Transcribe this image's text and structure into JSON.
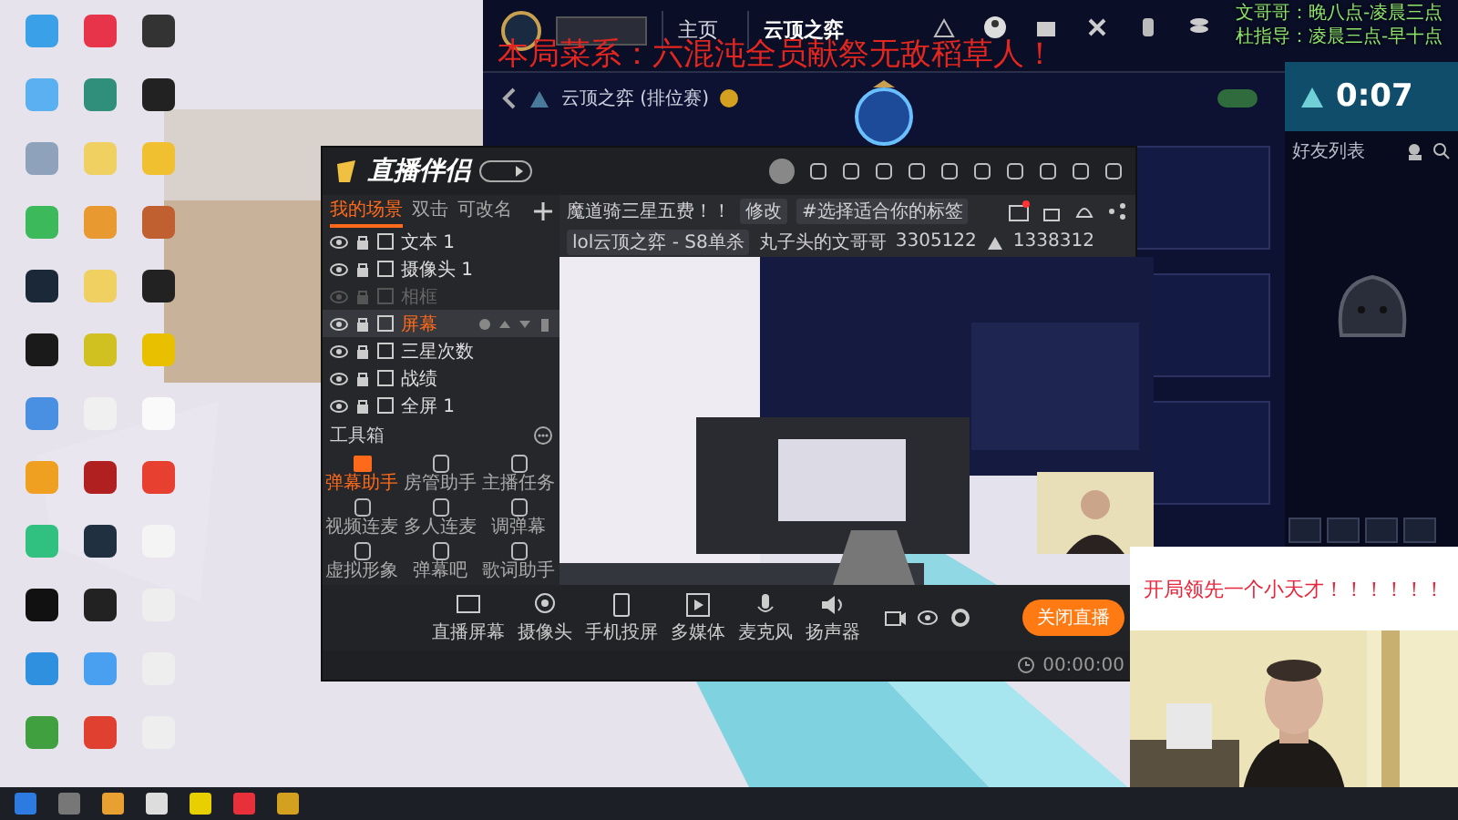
{
  "overlays": {
    "dish": "本局菜系：六混沌全员献祭无敌稻草人！",
    "schedule": [
      "文哥哥：晚八点-凌晨三点",
      "杜指导：凌晨三点-早十点"
    ],
    "caption": "开局领先一个小天才！！！！！！"
  },
  "game_client": {
    "nav": [
      {
        "label": "主页",
        "selected": false
      },
      {
        "label": "云顶之弈",
        "selected": true
      }
    ],
    "mode": "云顶之弈 (排位赛)",
    "toggle_on": true,
    "queue_timer": "0:07",
    "friends_title": "好友列表"
  },
  "streamer": {
    "title": "直播伴侣",
    "scene_tabs": [
      {
        "label": "我的场景",
        "selected": true
      },
      {
        "label": "双击",
        "selected": false
      },
      {
        "label": "可改名",
        "selected": false
      }
    ],
    "sources": [
      {
        "name": "文本 1",
        "visible": true,
        "selected": false
      },
      {
        "name": "摄像头 1",
        "visible": true,
        "selected": false
      },
      {
        "name": "相框",
        "visible": false,
        "selected": false
      },
      {
        "name": "屏幕",
        "visible": true,
        "selected": true
      },
      {
        "name": "三星次数",
        "visible": true,
        "selected": false
      },
      {
        "name": "战绩",
        "visible": true,
        "selected": false
      },
      {
        "name": "全屏 1",
        "visible": true,
        "selected": false
      }
    ],
    "toolbox_title": "工具箱",
    "tools": [
      {
        "label": "弹幕助手",
        "active": true
      },
      {
        "label": "房管助手",
        "active": false
      },
      {
        "label": "主播任务",
        "active": false
      },
      {
        "label": "视频连麦",
        "active": false
      },
      {
        "label": "多人连麦",
        "active": false
      },
      {
        "label": "调弹幕",
        "active": false
      },
      {
        "label": "虚拟形象",
        "active": false
      },
      {
        "label": "弹幕吧",
        "active": false
      },
      {
        "label": "歌词助手",
        "active": false
      }
    ],
    "stream_title": "魔道骑三星五费！！",
    "edit": "修改",
    "tag": "#选择适合你的标签",
    "category": "lol云顶之弈 - S8单杀",
    "anchor": "丸子头的文哥哥",
    "room_id": "3305122",
    "fans": "1338312",
    "controls": [
      "直播屏幕",
      "摄像头",
      "手机投屏",
      "多媒体",
      "麦克风",
      "扬声器"
    ],
    "live_button": "关闭直播",
    "timer": "00:00:00"
  }
}
